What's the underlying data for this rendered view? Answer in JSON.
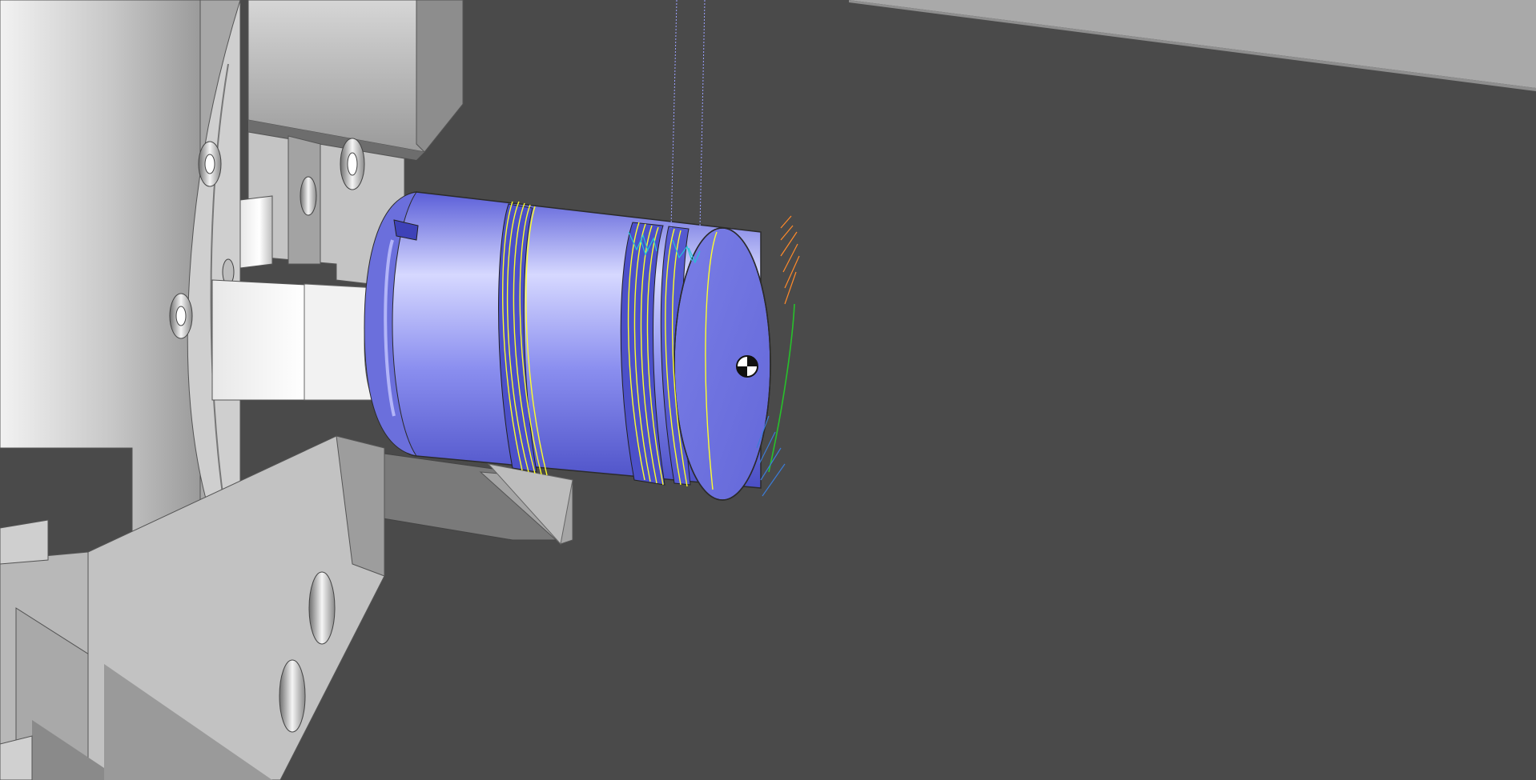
{
  "viewport": {
    "background": "#4a4a4a",
    "mode": "toolpath-simulation"
  },
  "colors": {
    "machine": "#bdbdbd",
    "machine_dark": "#8d8d8d",
    "part": "#7c80e6",
    "part_highlight": "#d6d8ff",
    "toolpath_yellow": "#ffff2a",
    "toolpath_cyan": "#21c6d8",
    "toolpath_orange": "#ff8a2a",
    "toolpath_green": "#27c22b",
    "toolpath_blue": "#3b7bd7"
  },
  "icons": {
    "origin": "work-origin-icon"
  }
}
